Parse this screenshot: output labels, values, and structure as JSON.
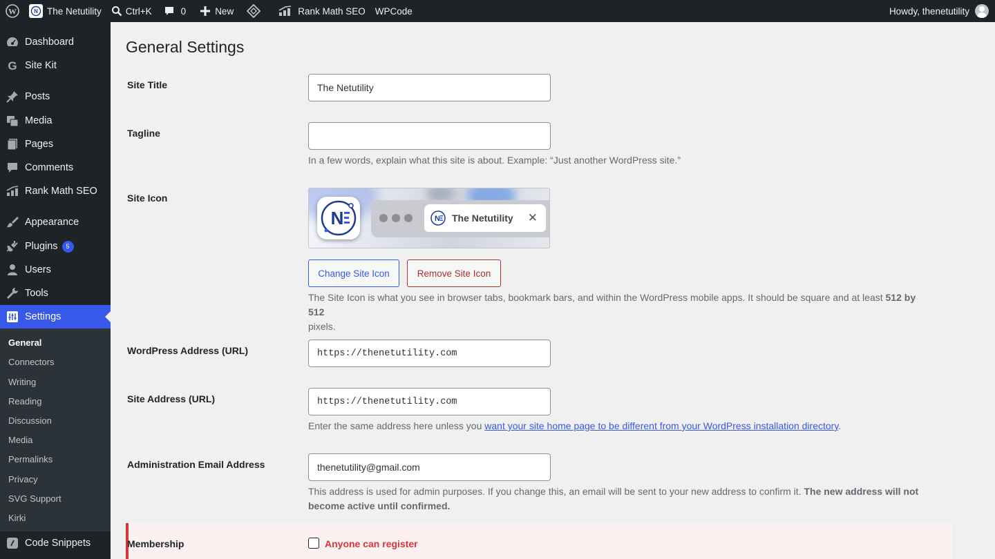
{
  "adminbar": {
    "site_name": "The Netutility",
    "search_shortcut": "Ctrl+K",
    "comments_count": "0",
    "new_label": "New",
    "rank_math_label": "Rank Math SEO",
    "wpcode_label": "WPCode",
    "howdy": "Howdy, thenetutility"
  },
  "sidebar": {
    "items": [
      {
        "label": "Dashboard",
        "icon": "dashboard-icon"
      },
      {
        "label": "Site Kit",
        "icon": "google-g-icon"
      },
      {
        "label": "Posts",
        "icon": "pushpin-icon"
      },
      {
        "label": "Media",
        "icon": "media-icon"
      },
      {
        "label": "Pages",
        "icon": "pages-icon"
      },
      {
        "label": "Comments",
        "icon": "comment-icon"
      },
      {
        "label": "Rank Math SEO",
        "icon": "rank-math-icon"
      },
      {
        "label": "Appearance",
        "icon": "paintbrush-icon"
      },
      {
        "label": "Plugins",
        "icon": "plugin-icon",
        "badge": "5"
      },
      {
        "label": "Users",
        "icon": "users-icon"
      },
      {
        "label": "Tools",
        "icon": "wrench-icon"
      },
      {
        "label": "Settings",
        "icon": "settings-icon"
      },
      {
        "label": "Code Snippets",
        "icon": "code-snippets-icon"
      }
    ],
    "submenu": [
      "General",
      "Connectors",
      "Writing",
      "Reading",
      "Discussion",
      "Media",
      "Permalinks",
      "Privacy",
      "SVG Support",
      "Kirki"
    ]
  },
  "main": {
    "page_title": "General Settings",
    "site_title": {
      "label": "Site Title",
      "value": "The Netutility"
    },
    "tagline": {
      "label": "Tagline",
      "value": "",
      "description": "In a few words, explain what this site is about. Example: “Just another WordPress site.”"
    },
    "site_icon": {
      "label": "Site Icon",
      "preview_tab_title": "The Netutility",
      "change_button": "Change Site Icon",
      "remove_button": "Remove Site Icon",
      "description_prefix": "The Site Icon is what you see in browser tabs, bookmark bars, and within the WordPress mobile apps. It should be square and at least ",
      "description_bold": "512 by 512",
      "description_suffix": "pixels."
    },
    "wp_address": {
      "label": "WordPress Address (URL)",
      "value": "https://thenetutility.com"
    },
    "site_address": {
      "label": "Site Address (URL)",
      "value": "https://thenetutility.com",
      "description_prefix": "Enter the same address here unless you ",
      "description_link": "want your site home page to be different from your WordPress installation directory",
      "description_suffix": "."
    },
    "admin_email": {
      "label": "Administration Email Address",
      "value": "thenetutility@gmail.com",
      "description_prefix": "This address is used for admin purposes. If you change this, an email will be sent to your new address to confirm it. ",
      "description_bold": "The new address will not become active until confirmed."
    },
    "membership": {
      "label": "Membership",
      "checkbox_label": "Anyone can register",
      "checked": false
    }
  },
  "colors": {
    "accent": "#3858e9",
    "admin_bar": "#1d2327",
    "danger": "#d63638",
    "page_bg": "#f0f0f1"
  }
}
